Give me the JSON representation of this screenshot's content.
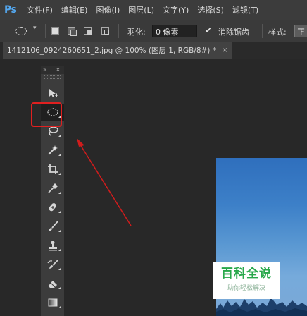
{
  "app": {
    "logo_text": "Ps"
  },
  "menu": [
    "文件(F)",
    "编辑(E)",
    "图像(I)",
    "图层(L)",
    "文字(Y)",
    "选择(S)",
    "滤镜(T)"
  ],
  "options_bar": {
    "tool_icon": "ellipse-marquee-icon",
    "feather_label": "羽化:",
    "feather_value": "0 像素",
    "antialias_checked": true,
    "antialias_label": "消除锯齿",
    "style_label": "样式:",
    "style_value": "正"
  },
  "document_tab": {
    "title": "1412106_0924260651_2.jpg @ 100% (图层 1, RGB/8#) *",
    "close": "×"
  },
  "tools_panel": {
    "collapse": "»",
    "close": "×",
    "tools": [
      "move-icon",
      "elliptical-marquee-icon",
      "lasso-icon",
      "quick-selection-icon",
      "crop-icon",
      "eyedropper-icon",
      "spot-healing-brush-icon",
      "brush-icon",
      "clone-stamp-icon",
      "history-brush-icon",
      "eraser-icon",
      "gradient-icon"
    ],
    "selected_tool": "elliptical-marquee-icon"
  },
  "annotation": {
    "color": "#e02020"
  },
  "watermark": {
    "title": "百科全说",
    "subtitle": "助你轻松解决"
  }
}
